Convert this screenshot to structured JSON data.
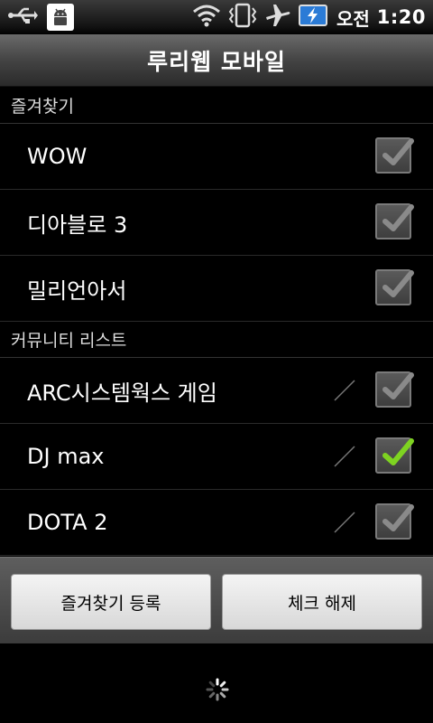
{
  "status_bar": {
    "ampm": "오전",
    "time": "1:20",
    "icons": [
      "usb-icon",
      "android-debug-icon",
      "wifi-icon",
      "vibrate-icon",
      "airplane-icon",
      "battery-charging-icon"
    ]
  },
  "title": "루리웹 모바일",
  "sections": [
    {
      "header": "즐겨찾기",
      "items": [
        {
          "label": "WOW",
          "checked": false,
          "editable": false
        },
        {
          "label": "디아블로 3",
          "checked": false,
          "editable": false
        },
        {
          "label": "밀리언아서",
          "checked": false,
          "editable": false
        }
      ]
    },
    {
      "header": "커뮤니티 리스트",
      "items": [
        {
          "label": "ARC시스템웍스 게임",
          "checked": false,
          "editable": true
        },
        {
          "label": "DJ max",
          "checked": true,
          "editable": true
        },
        {
          "label": "DOTA 2",
          "checked": false,
          "editable": true
        }
      ]
    }
  ],
  "buttons": {
    "register_favorites": "즐겨찾기 등록",
    "uncheck_all": "체크 해제"
  },
  "colors": {
    "check_on": "#7ed321",
    "check_off": "#8a8a8a"
  }
}
